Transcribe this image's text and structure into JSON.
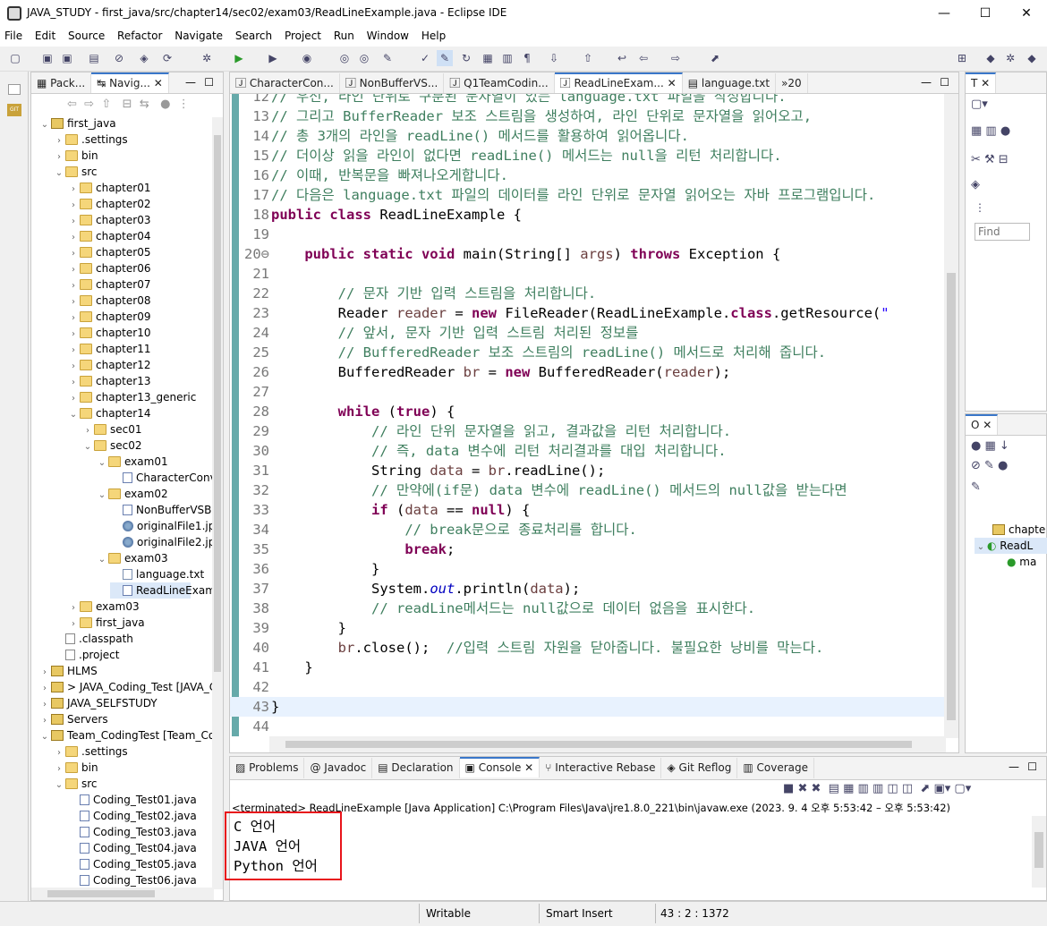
{
  "window": {
    "title": "JAVA_STUDY - first_java/src/chapter14/sec02/exam03/ReadLineExample.java - Eclipse IDE",
    "minimize": "—",
    "maximize": "☐",
    "close": "✕"
  },
  "menu": [
    "File",
    "Edit",
    "Source",
    "Refactor",
    "Navigate",
    "Search",
    "Project",
    "Run",
    "Window",
    "Help"
  ],
  "explorer": {
    "tabs": [
      "Pack...",
      "Navig..."
    ],
    "tree": [
      {
        "label": "first_java",
        "kind": "proj",
        "depth": 0,
        "open": true
      },
      {
        "label": ".settings",
        "kind": "folder",
        "depth": 1
      },
      {
        "label": "bin",
        "kind": "folder",
        "depth": 1
      },
      {
        "label": "src",
        "kind": "folder",
        "depth": 1,
        "open": true
      },
      {
        "label": "chapter01",
        "kind": "folder",
        "depth": 2
      },
      {
        "label": "chapter02",
        "kind": "folder",
        "depth": 2
      },
      {
        "label": "chapter03",
        "kind": "folder",
        "depth": 2
      },
      {
        "label": "chapter04",
        "kind": "folder",
        "depth": 2
      },
      {
        "label": "chapter05",
        "kind": "folder",
        "depth": 2
      },
      {
        "label": "chapter06",
        "kind": "folder",
        "depth": 2
      },
      {
        "label": "chapter07",
        "kind": "folder",
        "depth": 2
      },
      {
        "label": "chapter08",
        "kind": "folder",
        "depth": 2
      },
      {
        "label": "chapter09",
        "kind": "folder",
        "depth": 2
      },
      {
        "label": "chapter10",
        "kind": "folder",
        "depth": 2
      },
      {
        "label": "chapter11",
        "kind": "folder",
        "depth": 2
      },
      {
        "label": "chapter12",
        "kind": "folder",
        "depth": 2
      },
      {
        "label": "chapter13",
        "kind": "folder",
        "depth": 2
      },
      {
        "label": "chapter13_generic",
        "kind": "folder",
        "depth": 2
      },
      {
        "label": "chapter14",
        "kind": "folder",
        "depth": 2,
        "open": true
      },
      {
        "label": "sec01",
        "kind": "folder",
        "depth": 3
      },
      {
        "label": "sec02",
        "kind": "folder",
        "depth": 3,
        "open": true
      },
      {
        "label": "exam01",
        "kind": "folder",
        "depth": 4,
        "open": true
      },
      {
        "label": "CharacterConv",
        "kind": "java",
        "depth": 5
      },
      {
        "label": "exam02",
        "kind": "folder",
        "depth": 4,
        "open": true
      },
      {
        "label": "NonBufferVSB",
        "kind": "java",
        "depth": 5
      },
      {
        "label": "originalFile1.jp",
        "kind": "img",
        "depth": 5
      },
      {
        "label": "originalFile2.jp",
        "kind": "img",
        "depth": 5
      },
      {
        "label": "exam03",
        "kind": "folder",
        "depth": 4,
        "open": true
      },
      {
        "label": "language.txt",
        "kind": "file",
        "depth": 5
      },
      {
        "label": "ReadLineExam",
        "kind": "java",
        "depth": 5,
        "selected": true
      },
      {
        "label": "exam03",
        "kind": "folder",
        "depth": 2
      },
      {
        "label": "first_java",
        "kind": "folder",
        "depth": 2
      },
      {
        "label": ".classpath",
        "kind": "xml",
        "depth": 1
      },
      {
        "label": ".project",
        "kind": "xml",
        "depth": 1
      },
      {
        "label": "HLMS",
        "kind": "proj",
        "depth": 0
      },
      {
        "label": "> JAVA_Coding_Test [JAVA_C",
        "kind": "proj",
        "depth": 0
      },
      {
        "label": "JAVA_SELFSTUDY",
        "kind": "proj",
        "depth": 0
      },
      {
        "label": "Servers",
        "kind": "proj",
        "depth": 0
      },
      {
        "label": "Team_CodingTest [Team_Coc",
        "kind": "proj",
        "depth": 0,
        "open": true
      },
      {
        "label": ".settings",
        "kind": "folder",
        "depth": 1
      },
      {
        "label": "bin",
        "kind": "folder",
        "depth": 1
      },
      {
        "label": "src",
        "kind": "folder",
        "depth": 1,
        "open": true
      },
      {
        "label": "Coding_Test01.java",
        "kind": "java",
        "depth": 2
      },
      {
        "label": "Coding_Test02.java",
        "kind": "java",
        "depth": 2
      },
      {
        "label": "Coding_Test03.java",
        "kind": "java",
        "depth": 2
      },
      {
        "label": "Coding_Test04.java",
        "kind": "java",
        "depth": 2
      },
      {
        "label": "Coding_Test05.java",
        "kind": "java",
        "depth": 2
      },
      {
        "label": "Coding_Test06.java",
        "kind": "java",
        "depth": 2
      }
    ]
  },
  "editor": {
    "tabs": [
      "CharacterCon...",
      "NonBufferVS...",
      "Q1TeamCodin...",
      "ReadLineExam...",
      "language.txt",
      "»20"
    ],
    "lines": [
      {
        "n": "12",
        "html": "<span class=\"cm\">// 우선, 라인 단위로 구분된 문자열이 있는 language.txt 파일을 작성합니다.</span>"
      },
      {
        "n": "13",
        "html": "<span class=\"cm\">// 그리고 BufferReader 보조 스트림을 생성하여, 라인 단위로 문자열을 읽어오고,</span>"
      },
      {
        "n": "14",
        "html": "<span class=\"cm\">// 총 3개의 라인을 readLine() 메서드를 활용하여 읽어옵니다.</span>"
      },
      {
        "n": "15",
        "html": "<span class=\"cm\">// 더이상 읽을 라인이 없다면 readLine() 메서드는 null을 리턴 처리합니다.</span>"
      },
      {
        "n": "16",
        "html": "<span class=\"cm\">// 이때, 반복문을 빠져나오게합니다.</span>"
      },
      {
        "n": "17",
        "html": "<span class=\"cm\">// 다음은 language.txt 파일의 데이터를 라인 단위로 문자열 읽어오는 자바 프로그램입니다.</span>"
      },
      {
        "n": "18",
        "html": "<span class=\"kw\">public class</span> ReadLineExample {"
      },
      {
        "n": "19",
        "html": ""
      },
      {
        "n": "20⊖",
        "html": "    <span class=\"kw\">public static void</span> main(String[] <span class=\"lv\">args</span>) <span class=\"kw\">throws</span> Exception {"
      },
      {
        "n": "21",
        "html": ""
      },
      {
        "n": "22",
        "html": "        <span class=\"cm\">// 문자 기반 입력 스트림을 처리합니다.</span>"
      },
      {
        "n": "23",
        "html": "        Reader <span class=\"lv\">reader</span> = <span class=\"kw\">new</span> FileReader(ReadLineExample.<span class=\"kw\">class</span>.getResource(<span class=\"st\">\"</span>"
      },
      {
        "n": "24",
        "html": "        <span class=\"cm\">// 앞서, 문자 기반 입력 스트림 처리된 정보를</span>"
      },
      {
        "n": "25",
        "html": "        <span class=\"cm\">// BufferedReader 보조 스트림의 readLine() 메서드로 처리해 줍니다.</span>"
      },
      {
        "n": "26",
        "html": "        BufferedReader <span class=\"lv\">br</span> = <span class=\"kw\">new</span> BufferedReader(<span class=\"lv\">reader</span>);"
      },
      {
        "n": "27",
        "html": ""
      },
      {
        "n": "28",
        "html": "        <span class=\"kw\">while</span> (<span class=\"kw\">true</span>) {"
      },
      {
        "n": "29",
        "html": "            <span class=\"cm\">// 라인 단위 문자열을 읽고, 결과값을 리턴 처리합니다.</span>"
      },
      {
        "n": "30",
        "html": "            <span class=\"cm\">// 즉, data 변수에 리턴 처리결과를 대입 처리합니다.</span>"
      },
      {
        "n": "31",
        "html": "            String <span class=\"lv\">data</span> = <span class=\"lv\">br</span>.readLine();"
      },
      {
        "n": "32",
        "html": "            <span class=\"cm\">// 만약에(if문) data 변수에 readLine() 메서드의 null값을 받는다면</span>"
      },
      {
        "n": "33",
        "html": "            <span class=\"kw\">if</span> (<span class=\"lv\">data</span> == <span class=\"kw\">null</span>) {"
      },
      {
        "n": "34",
        "html": "                <span class=\"cm\">// break문으로 종료처리를 합니다.</span>"
      },
      {
        "n": "35",
        "html": "                <span class=\"kw\">break</span>;"
      },
      {
        "n": "36",
        "html": "            }"
      },
      {
        "n": "37",
        "html": "            System.<span class=\"fl\">out</span>.println(<span class=\"lv\">data</span>);"
      },
      {
        "n": "38",
        "html": "            <span class=\"cm\">// readLine메서드는 null값으로 데이터 없음을 표시한다.</span>"
      },
      {
        "n": "39",
        "html": "        }"
      },
      {
        "n": "40",
        "html": "        <span class=\"lv\">br</span>.close();  <span class=\"cm\">//입력 스트림 자원을 닫아줍니다. 불필요한 낭비를 막는다.</span>"
      },
      {
        "n": "41",
        "html": "    }"
      },
      {
        "n": "42",
        "html": ""
      },
      {
        "n": "43",
        "html": "}",
        "current": true
      },
      {
        "n": "44",
        "html": ""
      }
    ]
  },
  "right_top": {
    "tab": "T",
    "find_placeholder": "Find"
  },
  "outline": {
    "tab": "O",
    "items": [
      "chapte",
      "ReadL",
      "ma"
    ]
  },
  "console": {
    "tabs": [
      "Problems",
      "@ Javadoc",
      "Declaration",
      "Console",
      "Interactive Rebase",
      "Git Reflog",
      "Coverage"
    ],
    "header": "<terminated> ReadLineExample [Java Application] C:\\Program Files\\Java\\jre1.8.0_221\\bin\\javaw.exe  (2023. 9. 4 오후 5:53:42 – 오후 5:53:42)",
    "output": [
      "C 언어",
      "JAVA 언어",
      "Python 언어"
    ]
  },
  "status": {
    "writable": "Writable",
    "insert": "Smart Insert",
    "position": "43 : 2 : 1372"
  },
  "colors": {
    "highlight": "#e8141b",
    "accent": "#3a77c9"
  }
}
